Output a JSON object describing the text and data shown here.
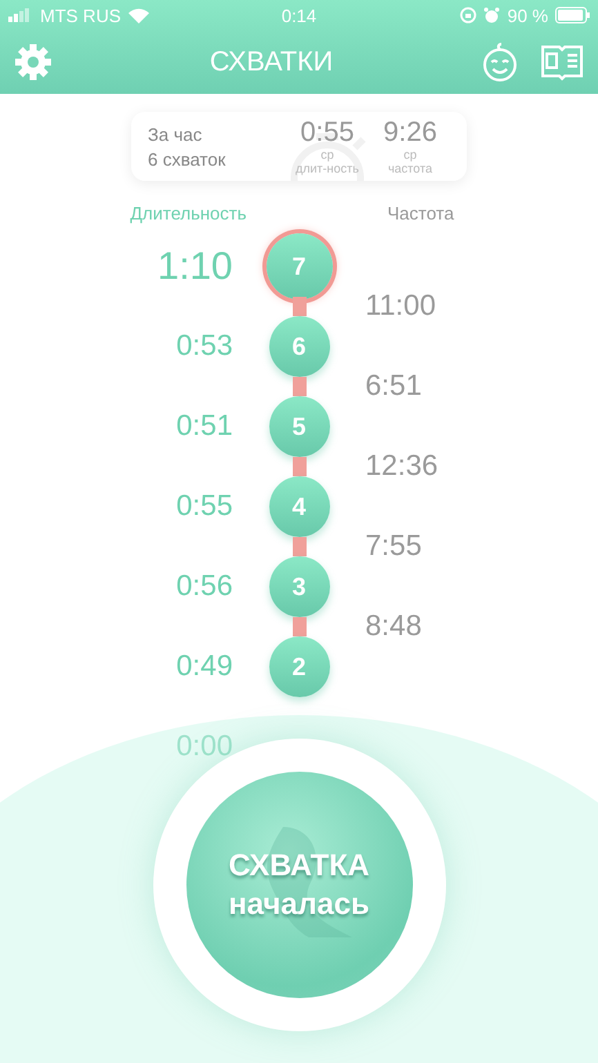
{
  "status_bar": {
    "carrier": "MTS RUS",
    "time": "0:14",
    "battery": "90 %"
  },
  "header": {
    "title": "СХВАТКИ"
  },
  "summary": {
    "period": "За час",
    "count": "6 схваток",
    "stats": [
      {
        "value": "0:55",
        "qualifier": "ср",
        "label": "длит-ность"
      },
      {
        "value": "9:26",
        "qualifier": "ср",
        "label": "частота"
      }
    ]
  },
  "columns": [
    {
      "label": "Длительность",
      "selected": true
    },
    {
      "label": "Частота",
      "selected": false
    }
  ],
  "contractions": [
    {
      "number": "7",
      "duration": "1:10",
      "current": true,
      "faded": false
    },
    {
      "number": "6",
      "duration": "0:53",
      "current": false,
      "faded": false
    },
    {
      "number": "5",
      "duration": "0:51",
      "current": false,
      "faded": false
    },
    {
      "number": "4",
      "duration": "0:55",
      "current": false,
      "faded": false
    },
    {
      "number": "3",
      "duration": "0:56",
      "current": false,
      "faded": false
    },
    {
      "number": "2",
      "duration": "0:49",
      "current": false,
      "faded": false
    },
    {
      "duration": "0:00",
      "current": false,
      "faded": true
    }
  ],
  "intervals": [
    "11:00",
    "6:51",
    "12:36",
    "7:55",
    "8:48"
  ],
  "start_button": {
    "line_1": "СХВАТКА",
    "line_2": "началась"
  }
}
